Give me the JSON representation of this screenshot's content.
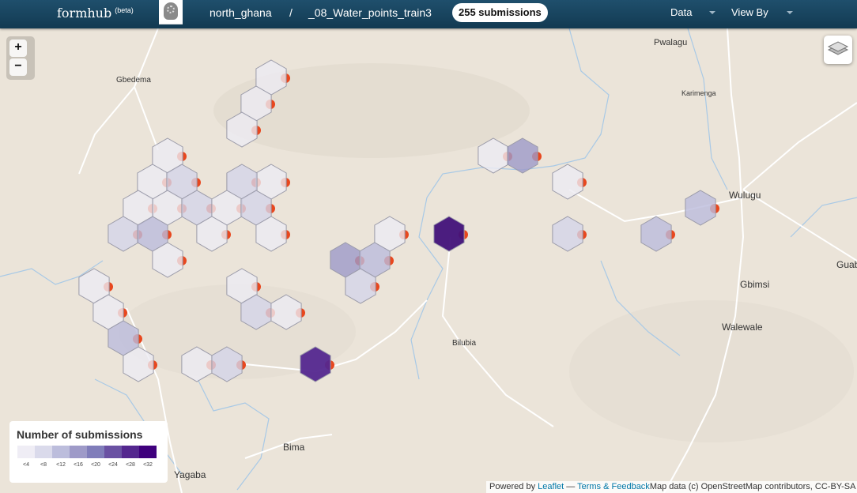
{
  "header": {
    "brand": "formhub",
    "brand_tag": "(beta)",
    "account": "north_ghana",
    "separator": "/",
    "form": "_08_Water_points_train3",
    "submissions_badge": "255 submissions",
    "menus": [
      {
        "label": "Data",
        "icon": "caret-down-icon"
      },
      {
        "label": "View By",
        "icon": "caret-down-icon"
      }
    ]
  },
  "map": {
    "zoom_in": "+",
    "zoom_out": "−",
    "layers_icon": "layers-icon",
    "place_labels": [
      "Pwalagu",
      "Gbedema",
      "Karimenga",
      "Wulugu",
      "Guab",
      "Gbimsi",
      "Walewale",
      "Bilubia",
      "Bima",
      "Yagaba"
    ],
    "legend": {
      "title": "Number of submissions",
      "bins": [
        "<4",
        "<8",
        "<12",
        "<16",
        "<20",
        "<24",
        "<28",
        "<32"
      ],
      "colors": [
        "#efedf5",
        "#dadaeb",
        "#bcbddc",
        "#9e9ac8",
        "#807dba",
        "#6a51a3",
        "#54278f",
        "#3f007d"
      ]
    },
    "attribution": {
      "powered": "Powered by",
      "leaflet": "Leaflet",
      "dash": "—",
      "terms": "Terms & Feedback",
      "osm": "Map data (c) OpenStreetMap contributors, CC-BY-SA"
    }
  }
}
